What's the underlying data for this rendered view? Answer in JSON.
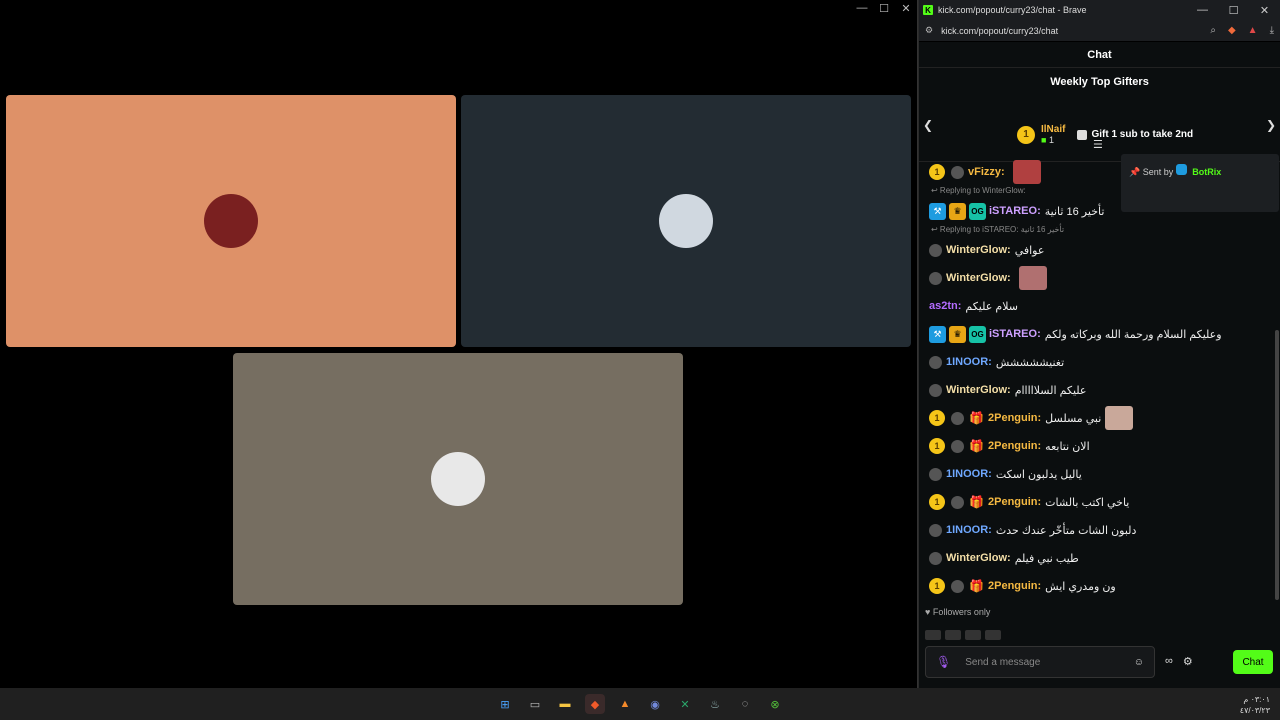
{
  "browser": {
    "title": "kick.com/popout/curry23/chat - Brave",
    "url": "kick.com/popout/curry23/chat"
  },
  "chat": {
    "header": "Chat",
    "gifters_title": "Weekly Top Gifters",
    "top_gifter": {
      "rank": "1",
      "name": "IlNaif",
      "count": "1"
    },
    "gift_cta": "Gift 1 sub to take 2nd",
    "pinned": {
      "label": "Sent by",
      "bot": "BotRix"
    },
    "followers_only": "Followers only",
    "composer_placeholder": "Send a message",
    "send_label": "Chat"
  },
  "messages": [
    {
      "reply": "",
      "coin": "1",
      "badges": [
        "bot"
      ],
      "user": "vFizzy",
      "color": "#f5b942",
      "text": "",
      "emote": "#b04040"
    },
    {
      "reply": "Replying to WinterGlow:",
      "coin": "",
      "badges": [
        "blue",
        "gold",
        "og"
      ],
      "user": "iSTAREO",
      "color": "#cda0ff",
      "text": "تأخير 16 ثانية",
      "emote": ""
    },
    {
      "reply": "Replying to iSTAREO: تأخير 16 ثانية",
      "coin": "",
      "badges": [
        "bot"
      ],
      "user": "WinterGlow",
      "color": "#f4dfa8",
      "text": "عوافي",
      "emote": ""
    },
    {
      "reply": "",
      "coin": "",
      "badges": [
        "bot"
      ],
      "user": "WinterGlow",
      "color": "#f4dfa8",
      "text": "",
      "emote": "#b07070"
    },
    {
      "reply": "",
      "coin": "",
      "badges": [],
      "user": "as2tn",
      "color": "#b46cff",
      "text": "سلام عليكم",
      "emote": ""
    },
    {
      "reply": "",
      "coin": "",
      "badges": [
        "blue",
        "gold",
        "og"
      ],
      "user": "iSTAREO",
      "color": "#cda0ff",
      "text": "وعليكم السلام ورحمة الله وبركاته ولكم",
      "emote": ""
    },
    {
      "reply": "",
      "coin": "",
      "badges": [
        "bot"
      ],
      "user": "1INOOR",
      "color": "#6fa8ff",
      "text": "تغنيششششش",
      "emote": ""
    },
    {
      "reply": "",
      "coin": "",
      "badges": [
        "bot"
      ],
      "user": "WinterGlow",
      "color": "#f4dfa8",
      "text": "عليكم السلااااام",
      "emote": ""
    },
    {
      "reply": "",
      "coin": "1",
      "badges": [
        "bot",
        "gift"
      ],
      "user": "2Penguin",
      "color": "#f5b942",
      "text": "نبي مسلسل",
      "emote": "#c9a89a"
    },
    {
      "reply": "",
      "coin": "1",
      "badges": [
        "bot",
        "gift"
      ],
      "user": "2Penguin",
      "color": "#f5b942",
      "text": "الان نتابعه",
      "emote": ""
    },
    {
      "reply": "",
      "coin": "",
      "badges": [
        "bot"
      ],
      "user": "1INOOR",
      "color": "#6fa8ff",
      "text": "ياليل يدلبون اسكت",
      "emote": ""
    },
    {
      "reply": "",
      "coin": "1",
      "badges": [
        "bot",
        "gift"
      ],
      "user": "2Penguin",
      "color": "#f5b942",
      "text": "ياخي اكتب بالشات",
      "emote": ""
    },
    {
      "reply": "",
      "coin": "",
      "badges": [
        "bot"
      ],
      "user": "1INOOR",
      "color": "#6fa8ff",
      "text": "دلبون الشات متأخّر عندك حدث",
      "emote": ""
    },
    {
      "reply": "",
      "coin": "",
      "badges": [
        "bot"
      ],
      "user": "WinterGlow",
      "color": "#f4dfa8",
      "text": "طيب نبي فيلم",
      "emote": ""
    },
    {
      "reply": "",
      "coin": "1",
      "badges": [
        "bot",
        "gift"
      ],
      "user": "2Penguin",
      "color": "#f5b942",
      "text": "ون ومدري ايش",
      "emote": ""
    }
  ],
  "tiles": [
    {
      "bg": "#de9168",
      "avatar": "#7a2020"
    },
    {
      "bg": "#232c33",
      "avatar": "#d0d8e0"
    },
    {
      "bg": "#766e61",
      "avatar": "#e8e8e8"
    }
  ],
  "taskbar": {
    "time": "٠٣:٠١ م",
    "date": "٤٧/٠٣/٢٣"
  }
}
